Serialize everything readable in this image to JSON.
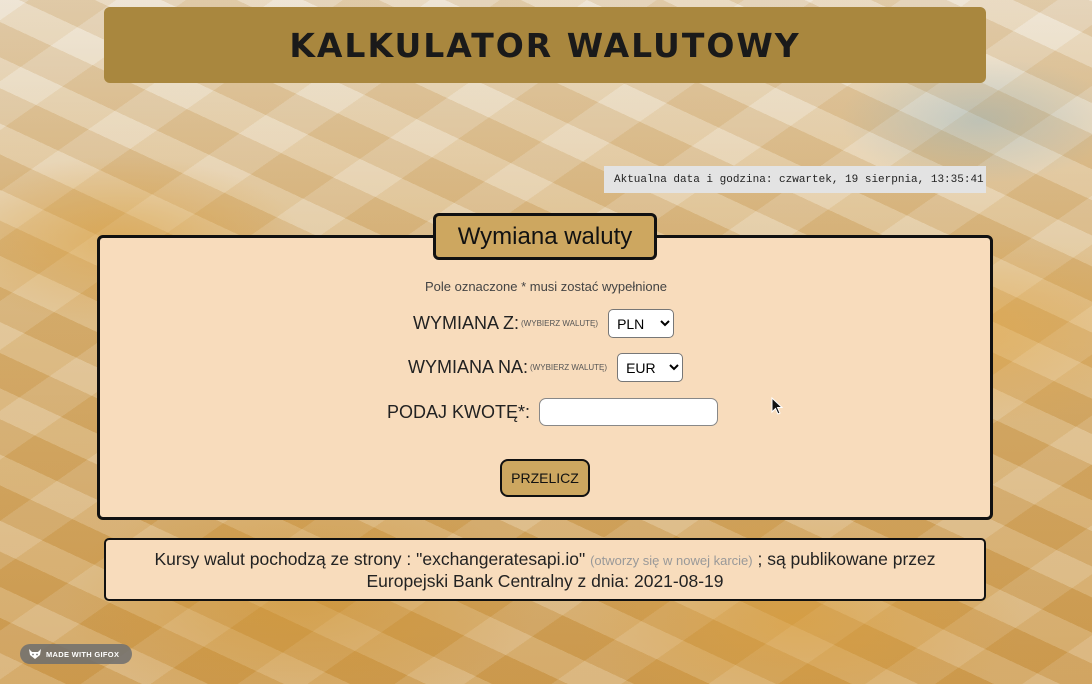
{
  "header": {
    "title": "KALKULATOR WALUTOWY"
  },
  "datetime": {
    "text": "Aktualna data i godzina: czwartek, 19 sierpnia, 13:35:41"
  },
  "panel": {
    "legend": "Wymiana waluty",
    "required_note": "Pole oznaczone * musi zostać wypełnione",
    "from": {
      "label": "WYMIANA Z:",
      "hint": "(WYBIERZ WALUTĘ)",
      "selected": "PLN"
    },
    "to": {
      "label": "WYMIANA NA:",
      "hint": "(WYBIERZ WALUTĘ)",
      "selected": "EUR"
    },
    "amount": {
      "label": "PODAJ KWOTĘ*:",
      "value": "",
      "placeholder": ""
    },
    "submit_label": "PRZELICZ"
  },
  "footer": {
    "text_before": "Kursy walut pochodzą ze strony : \"exchangeratesapi.io\"",
    "note": "(otworzy się w nowej karcie)",
    "text_after": "; są publikowane przez",
    "line2": "Europejski Bank Centralny z dnia:  2021-08-19"
  },
  "watermark": {
    "label": "MADE WITH GIFOX"
  },
  "icons": {
    "watermark_logo": "fox-icon",
    "pointer": "mouse-cursor-icon"
  }
}
